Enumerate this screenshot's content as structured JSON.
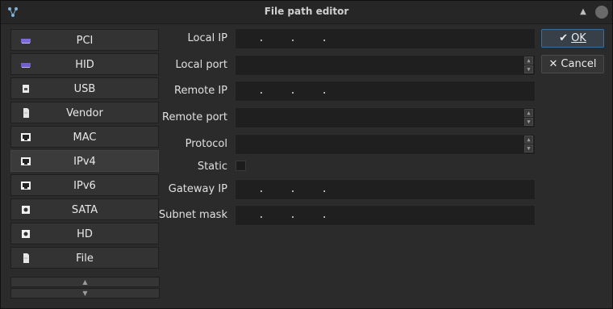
{
  "window": {
    "title": "File path editor"
  },
  "sidebar": {
    "items": [
      {
        "label": "PCI",
        "icon": "pci-card-icon"
      },
      {
        "label": "HID",
        "icon": "keyboard-icon"
      },
      {
        "label": "USB",
        "icon": "usb-drive-icon"
      },
      {
        "label": "Vendor",
        "icon": "file-icon"
      },
      {
        "label": "MAC",
        "icon": "network-port-icon"
      },
      {
        "label": "IPv4",
        "icon": "network-port-icon",
        "selected": true
      },
      {
        "label": "IPv6",
        "icon": "network-port-icon"
      },
      {
        "label": "SATA",
        "icon": "disk-icon"
      },
      {
        "label": "HD",
        "icon": "disk-icon"
      },
      {
        "label": "File",
        "icon": "file-icon"
      }
    ]
  },
  "form": {
    "local_ip_label": "Local IP",
    "local_port_label": "Local port",
    "remote_ip_label": "Remote IP",
    "remote_port_label": "Remote port",
    "protocol_label": "Protocol",
    "static_label": "Static",
    "gateway_ip_label": "Gateway IP",
    "subnet_mask_label": "Subnet mask",
    "ip_placeholder": ".    .    ."
  },
  "buttons": {
    "ok_label": "OK",
    "cancel_label": "Cancel"
  },
  "colors": {
    "accent": "#3d6e99",
    "window_bg": "#2b2b2b",
    "field_bg": "#1f1f1f"
  }
}
